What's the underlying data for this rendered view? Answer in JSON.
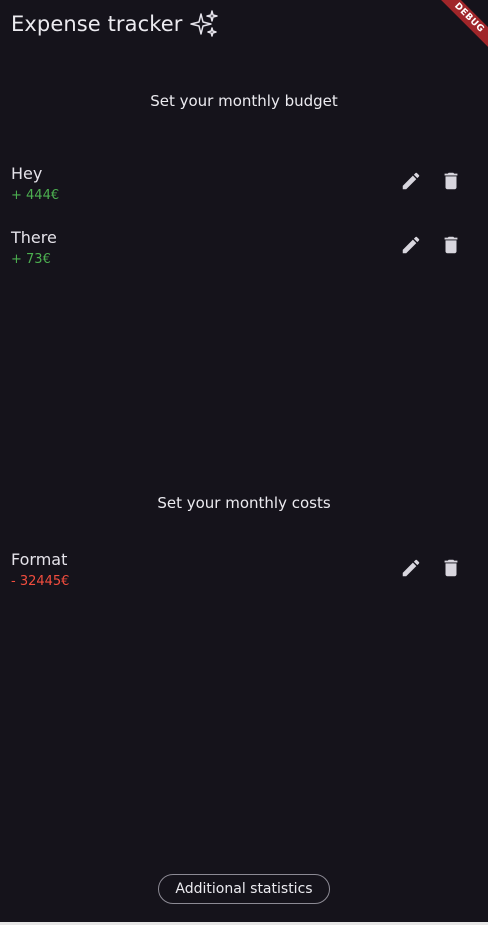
{
  "app": {
    "title": "Expense tracker",
    "title_icon": "sparkles-icon",
    "debug_banner": "DEBUG"
  },
  "budget": {
    "heading": "Set your monthly budget",
    "items": [
      {
        "name": "Hey",
        "amount": "+ 444€"
      },
      {
        "name": "There",
        "amount": "+ 73€"
      }
    ]
  },
  "costs": {
    "heading": "Set your monthly costs",
    "items": [
      {
        "name": "Format",
        "amount": "- 32445€"
      }
    ]
  },
  "footer": {
    "stats_button": "Additional statistics"
  },
  "colors": {
    "background": "#15131b",
    "income": "#4caf50",
    "expense": "#f24d3e",
    "icon": "#d8d6de"
  },
  "icons": {
    "edit": "pencil-icon",
    "delete": "trash-icon"
  }
}
